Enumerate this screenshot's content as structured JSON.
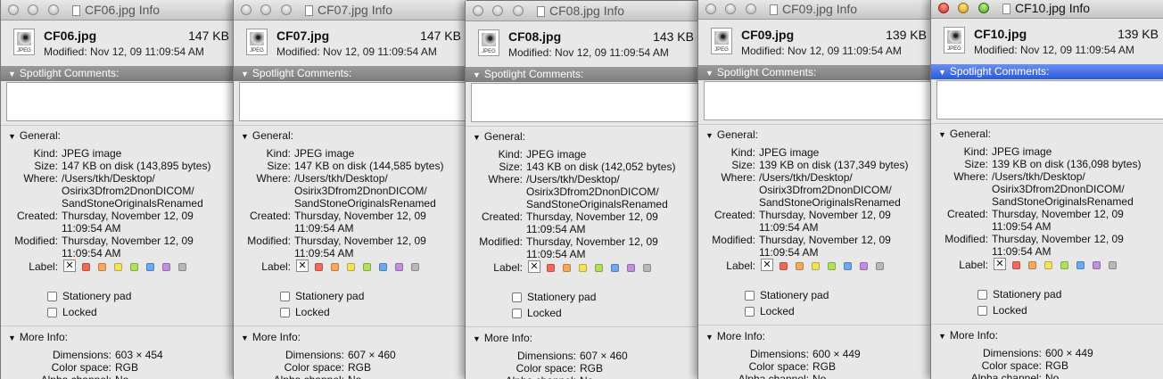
{
  "window_labels": {
    "spotlight": "Spotlight Comments:",
    "general": "General:",
    "kind_key": "Kind:",
    "size_key": "Size:",
    "where_key": "Where:",
    "created_key": "Created:",
    "modified_key": "Modified:",
    "label_key": "Label:",
    "label_none": "✕",
    "stationery": "Stationery pad",
    "locked": "Locked",
    "more_info": "More Info:",
    "dimensions_key": "Dimensions:",
    "colorspace_key": "Color space:",
    "alpha_key": "Alpha channel:"
  },
  "label_colors": [
    "#f06a5c",
    "#f5a95c",
    "#f2e35a",
    "#b3e05a",
    "#6fa8f0",
    "#c28fe0",
    "#b8b8b8"
  ],
  "accent_color": "#2a5ad8",
  "windows": [
    {
      "title": "CF06.jpg Info",
      "file_name": "CF06.jpg",
      "file_size": "147 KB",
      "modified_line": "Modified: Nov 12, 09 11:09:54 AM",
      "kind": "JPEG image",
      "size": "147 KB on disk (143,895 bytes)",
      "where": [
        "/Users/tkh/Desktop/",
        "Osirix3Dfrom2DnonDICOM/",
        "SandStoneOriginalsRenamed"
      ],
      "created": [
        "Thursday, November 12, 09",
        "11:09:54 AM"
      ],
      "modified": [
        "Thursday, November 12, 09",
        "11:09:54 AM"
      ],
      "dimensions": "603 × 454",
      "color_space": "RGB",
      "alpha": "No"
    },
    {
      "title": "CF07.jpg Info",
      "file_name": "CF07.jpg",
      "file_size": "147 KB",
      "modified_line": "Modified: Nov 12, 09 11:09:54 AM",
      "kind": "JPEG image",
      "size": "147 KB on disk (144,585 bytes)",
      "where": [
        "/Users/tkh/Desktop/",
        "Osirix3Dfrom2DnonDICOM/",
        "SandStoneOriginalsRenamed"
      ],
      "created": [
        "Thursday, November 12, 09",
        "11:09:54 AM"
      ],
      "modified": [
        "Thursday, November 12, 09",
        "11:09:54 AM"
      ],
      "dimensions": "607 × 460",
      "color_space": "RGB",
      "alpha": "No"
    },
    {
      "title": "CF08.jpg Info",
      "file_name": "CF08.jpg",
      "file_size": "143 KB",
      "modified_line": "Modified: Nov 12, 09 11:09:54 AM",
      "kind": "JPEG image",
      "size": "143 KB on disk (142,052 bytes)",
      "where": [
        "/Users/tkh/Desktop/",
        "Osirix3Dfrom2DnonDICOM/",
        "SandStoneOriginalsRenamed"
      ],
      "created": [
        "Thursday, November 12, 09",
        "11:09:54 AM"
      ],
      "modified": [
        "Thursday, November 12, 09",
        "11:09:54 AM"
      ],
      "dimensions": "607 × 460",
      "color_space": "RGB",
      "alpha": "No"
    },
    {
      "title": "CF09.jpg Info",
      "file_name": "CF09.jpg",
      "file_size": "139 KB",
      "modified_line": "Modified: Nov 12, 09 11:09:54 AM",
      "kind": "JPEG image",
      "size": "139 KB on disk (137,349 bytes)",
      "where": [
        "/Users/tkh/Desktop/",
        "Osirix3Dfrom2DnonDICOM/",
        "SandStoneOriginalsRenamed"
      ],
      "created": [
        "Thursday, November 12, 09",
        "11:09:54 AM"
      ],
      "modified": [
        "Thursday, November 12, 09",
        "11:09:54 AM"
      ],
      "dimensions": "600 × 449",
      "color_space": "RGB",
      "alpha": "No"
    },
    {
      "title": "CF10.jpg Info",
      "file_name": "CF10.jpg",
      "file_size": "139 KB",
      "modified_line": "Modified: Nov 12, 09 11:09:54 AM",
      "kind": "JPEG image",
      "size": "139 KB on disk (136,098 bytes)",
      "where": [
        "/Users/tkh/Desktop/",
        "Osirix3Dfrom2DnonDICOM/",
        "SandStoneOriginalsRenamed"
      ],
      "created": [
        "Thursday, November 12, 09",
        "11:09:54 AM"
      ],
      "modified": [
        "Thursday, November 12, 09",
        "11:09:54 AM"
      ],
      "dimensions": "600 × 449",
      "color_space": "RGB",
      "alpha": "No"
    }
  ]
}
